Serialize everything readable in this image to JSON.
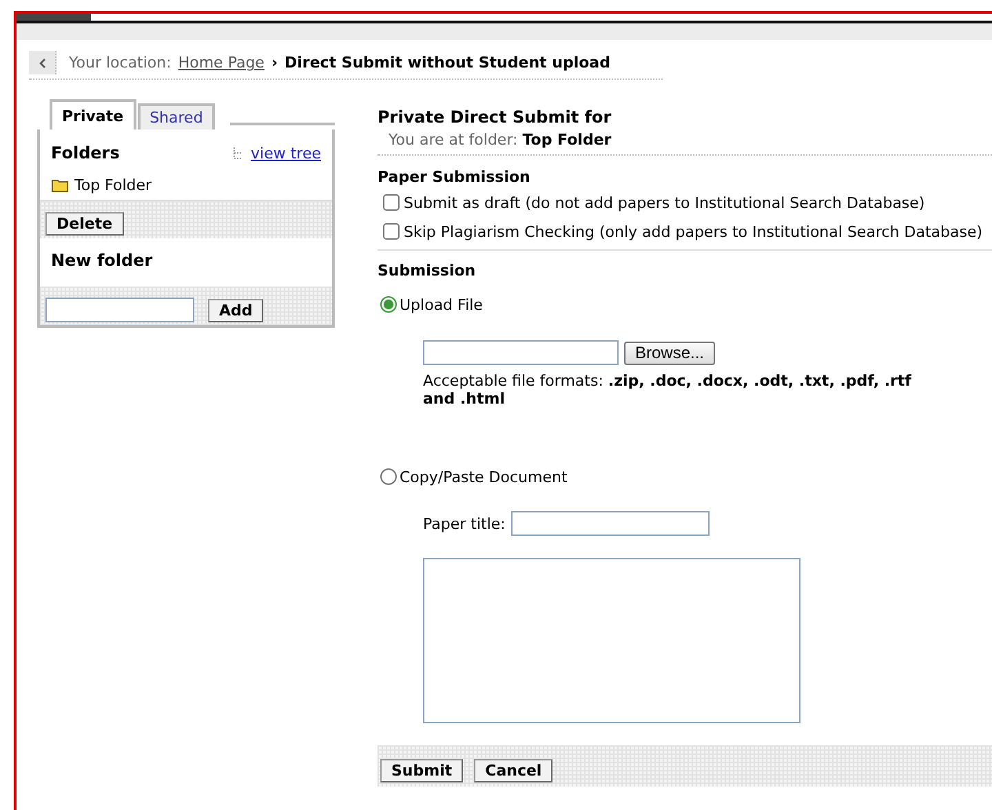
{
  "breadcrumb": {
    "prefix": "Your location:",
    "link": "Home Page",
    "separator": "›",
    "current": "Direct Submit without Student upload"
  },
  "sidebar": {
    "tabs": [
      {
        "label": "Private",
        "selected": true
      },
      {
        "label": "Shared",
        "selected": false
      }
    ],
    "folders_title": "Folders",
    "view_tree_link": "view tree",
    "folders": [
      {
        "name": "Top Folder"
      }
    ],
    "delete_button": "Delete",
    "new_folder_title": "New folder",
    "add_button": "Add"
  },
  "main": {
    "title": "Private Direct Submit for",
    "location_label": "You are at folder:",
    "location_value": "Top Folder",
    "paper_section": "Paper Submission",
    "options": [
      {
        "label": "Submit as draft (do not add papers to Institutional Search Database)",
        "checked": false
      },
      {
        "label": "Skip Plagiarism Checking (only add papers to Institutional Search Database)",
        "checked": false
      }
    ],
    "submission_section": "Submission",
    "methods": [
      {
        "label": "Upload File",
        "selected": true
      },
      {
        "label": "Copy/Paste Document",
        "selected": false
      }
    ],
    "browse_button": "Browse...",
    "formats_text": "Acceptable file formats: **.zip, .doc, .docx, .odt, .txt, .pdf, .rtf and .html**",
    "paper_title_label": "Paper title:",
    "buttons": [
      "Submit",
      "Cancel"
    ]
  }
}
